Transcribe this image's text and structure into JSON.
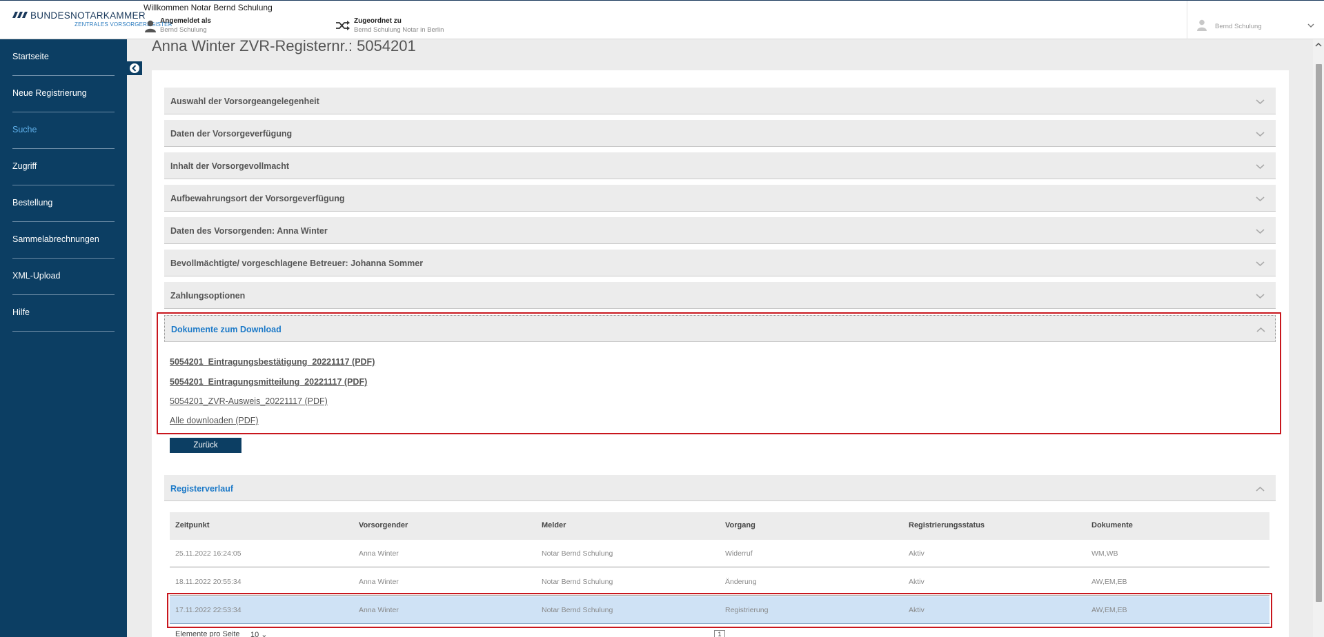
{
  "header": {
    "brand": "BUNDESNOTARKAMMER",
    "brand_sub": "ZENTRALES VORSORGEREGISTER",
    "welcome": "Willkommen Notar Bernd Schulung",
    "logged_in_label": "Angemeldet als",
    "logged_in_value": "Bernd Schulung",
    "assigned_label": "Zugeordnet zu",
    "assigned_value": "Bernd Schulung Notar in Berlin",
    "user_menu_name": "Bernd Schulung"
  },
  "sidebar": {
    "items": [
      {
        "label": "Startseite"
      },
      {
        "label": "Neue Registrierung"
      },
      {
        "label": "Suche"
      },
      {
        "label": "Zugriff"
      },
      {
        "label": "Bestellung"
      },
      {
        "label": "Sammelabrechnungen"
      },
      {
        "label": "XML-Upload"
      },
      {
        "label": "Hilfe"
      }
    ],
    "active": "Suche"
  },
  "main": {
    "title": "Anna Winter ZVR-Registernr.: 5054201",
    "sections": [
      {
        "label": "Auswahl der Vorsorgeangelegenheit",
        "expanded": false
      },
      {
        "label": "Daten der Vorsorgeverfügung",
        "expanded": false
      },
      {
        "label": "Inhalt der Vorsorgevollmacht",
        "expanded": false
      },
      {
        "label": "Aufbewahrungsort der Vorsorgeverfügung",
        "expanded": false
      },
      {
        "label": "Daten des Vorsorgenden: Anna Winter",
        "expanded": false
      },
      {
        "label": "Bevollmächtigte/ vorgeschlagene Betreuer: Johanna Sommer",
        "expanded": false
      },
      {
        "label": "Zahlungsoptionen",
        "expanded": false
      },
      {
        "label": "Dokumente zum Download",
        "expanded": true
      }
    ],
    "downloads": [
      "5054201_Eintragungsbestätigung_20221117 (PDF)",
      "5054201_Eintragungsmitteilung_20221117 (PDF)",
      "5054201_ZVR-Ausweis_20221117 (PDF)",
      "Alle downloaden (PDF)"
    ],
    "back_button": "Zurück",
    "register_history": {
      "title": "Registerverlauf",
      "columns": [
        "Zeitpunkt",
        "Vorsorgender",
        "Melder",
        "Vorgang",
        "Registrierungsstatus",
        "Dokumente"
      ],
      "rows": [
        [
          "25.11.2022 16:24:05",
          "Anna Winter",
          "Notar Bernd Schulung",
          "Widerruf",
          "Aktiv",
          "WM,WB"
        ],
        [
          "18.11.2022 20:55:34",
          "Anna Winter",
          "Notar Bernd Schulung",
          "Änderung",
          "Aktiv",
          "AW,EM,EB"
        ],
        [
          "17.11.2022 22:53:34",
          "Anna Winter",
          "Notar Bernd Schulung",
          "Registrierung",
          "Aktiv",
          "AW,EM,EB"
        ]
      ],
      "selected_row": 2,
      "per_page_label": "Elemente pro Seite",
      "per_page_value": "10",
      "current_page": "1"
    }
  },
  "colors": {
    "sidebar_bg": "#0c3e63",
    "accent_blue": "#1d7ac8",
    "highlight_red": "#c8161d",
    "selected_row": "#cfe2f5"
  }
}
